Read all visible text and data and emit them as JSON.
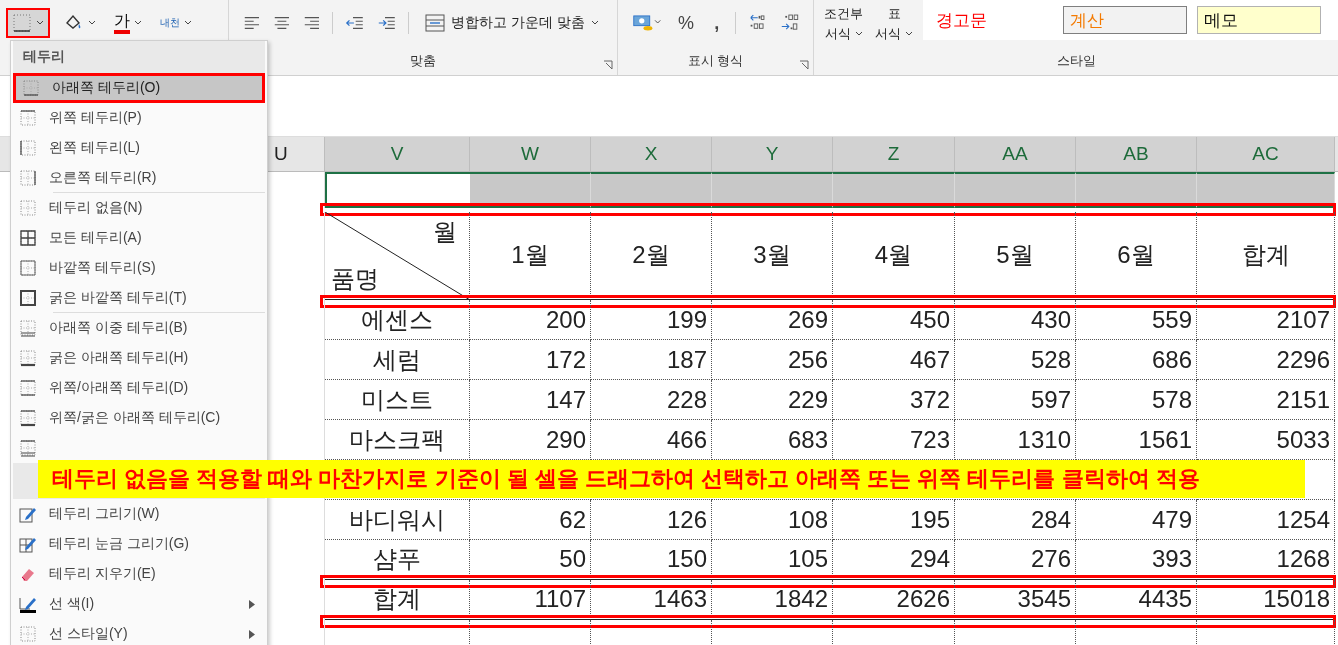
{
  "ribbon": {
    "font_group": [
      {
        "kind": "borders",
        "highlighted": true
      },
      {
        "kind": "fill",
        "highlighted": false
      },
      {
        "kind": "font-color",
        "label": "가",
        "highlighted": false
      },
      {
        "kind": "phonetic",
        "label": "내천",
        "highlighted": false
      }
    ],
    "align_group": {
      "label": "맞춤",
      "merge_button": "병합하고 가운데 맞춤"
    },
    "number_group": {
      "label": "표시 형식",
      "percent": "%",
      "comma": ","
    },
    "conditional": {
      "line1": "조건부",
      "line2": "서식"
    },
    "table_format": {
      "line1": "표",
      "line2": "서식"
    },
    "styles": {
      "label": "스타일",
      "items": [
        {
          "kind": "warning",
          "text": "경고문"
        },
        {
          "kind": "calc",
          "text": "계산"
        },
        {
          "kind": "memo",
          "text": "메모"
        }
      ]
    }
  },
  "menu": {
    "items": [
      {
        "kind": "header",
        "label": "테두리"
      },
      {
        "kind": "bottom",
        "label": "아래쪽 테두리(O)",
        "highlighted": true
      },
      {
        "kind": "top",
        "label": "위쪽 테두리(P)",
        "highlighted": false
      },
      {
        "kind": "left",
        "label": "왼쪽 테두리(L)",
        "highlighted": false
      },
      {
        "kind": "right",
        "label": "오른쪽 테두리(R)",
        "highlighted": false,
        "separator_after": true
      },
      {
        "kind": "none",
        "label": "테두리 없음(N)",
        "highlighted": false
      },
      {
        "kind": "all",
        "label": "모든 테두리(A)",
        "highlighted": false
      },
      {
        "kind": "outside",
        "label": "바깥쪽 테두리(S)",
        "highlighted": false
      },
      {
        "kind": "thick-outside",
        "label": "굵은 바깥쪽 테두리(T)",
        "highlighted": false,
        "separator_after": true
      },
      {
        "kind": "double-bottom",
        "label": "아래쪽 이중 테두리(B)",
        "highlighted": false
      },
      {
        "kind": "thick-bottom",
        "label": "굵은 아래쪽 테두리(H)",
        "highlighted": false
      },
      {
        "kind": "top-bottom",
        "label": "위쪽/아래쪽 테두리(D)",
        "highlighted": false
      },
      {
        "kind": "top-thick-bottom",
        "label": "위쪽/굵은 아래쪽 테두리(C)",
        "highlighted": false
      },
      {
        "kind": "top-double-bottom",
        "highlighted": false
      },
      {
        "kind": "header"
      },
      {
        "kind": "draw",
        "label": "테두리 그리기(W)",
        "highlighted": false
      },
      {
        "kind": "draw-grid",
        "label": "테두리 눈금 그리기(G)",
        "highlighted": false
      },
      {
        "kind": "erase",
        "label": "테두리 지우기(E)",
        "highlighted": false
      },
      {
        "kind": "line-color",
        "label": "선 색(I)",
        "highlighted": false,
        "submenu": true
      },
      {
        "kind": "line-style",
        "label": "선 스타일(Y)",
        "highlighted": false,
        "submenu": true
      }
    ]
  },
  "sheet": {
    "columns": [
      "U",
      "V",
      "W",
      "X",
      "Y",
      "Z",
      "AA",
      "AB",
      "AC"
    ],
    "selection_row": {
      "marked": true,
      "cells": [
        {
          "selected": false
        },
        {
          "selected": true
        },
        {
          "selected": true
        },
        {
          "selected": true
        },
        {
          "selected": true
        },
        {
          "selected": true
        },
        {
          "selected": true
        },
        {
          "selected": true
        }
      ]
    },
    "header_row": {
      "corner_top": "월",
      "corner_bottom": "품명",
      "months": [
        "1월",
        "2월",
        "3월",
        "4월",
        "5월",
        "6월",
        "합계"
      ],
      "double_rule_below": true,
      "marked": true
    },
    "rows": [
      {
        "kind": "data",
        "name": "에센스",
        "values": [
          "200",
          "199",
          "269",
          "450",
          "430",
          "559",
          "2107"
        ],
        "double_rule_below": false,
        "marked": false
      },
      {
        "kind": "data",
        "name": "세럼",
        "values": [
          "172",
          "187",
          "256",
          "467",
          "528",
          "686",
          "2296"
        ],
        "double_rule_below": false,
        "marked": false
      },
      {
        "kind": "data",
        "name": "미스트",
        "values": [
          "147",
          "228",
          "229",
          "372",
          "597",
          "578",
          "2151"
        ],
        "double_rule_below": false,
        "marked": false
      },
      {
        "kind": "data",
        "name": "마스크팩",
        "values": [
          "290",
          "466",
          "683",
          "723",
          "1310",
          "1561",
          "5033"
        ],
        "double_rule_below": false,
        "marked": false
      },
      {
        "kind": "note",
        "text": "테두리 없음을 적용할 때와 마찬가지로 기준이 될 셀을 드래그하여 선택하고 아래쪽 또는 위쪽 테두리를 클릭하여 적용",
        "double_rule_below": false,
        "marked": false
      },
      {
        "kind": "data",
        "name": "바디워시",
        "values": [
          "62",
          "126",
          "108",
          "195",
          "284",
          "479",
          "1254"
        ],
        "double_rule_below": false,
        "marked": false
      },
      {
        "kind": "data",
        "name": "샴푸",
        "values": [
          "50",
          "150",
          "105",
          "294",
          "276",
          "393",
          "1268"
        ],
        "double_rule_below": true,
        "marked": true
      },
      {
        "kind": "total",
        "name": "합계",
        "values": [
          "1107",
          "1463",
          "1842",
          "2626",
          "3545",
          "4435",
          "15018"
        ],
        "double_rule_below": true,
        "marked": true
      }
    ]
  }
}
